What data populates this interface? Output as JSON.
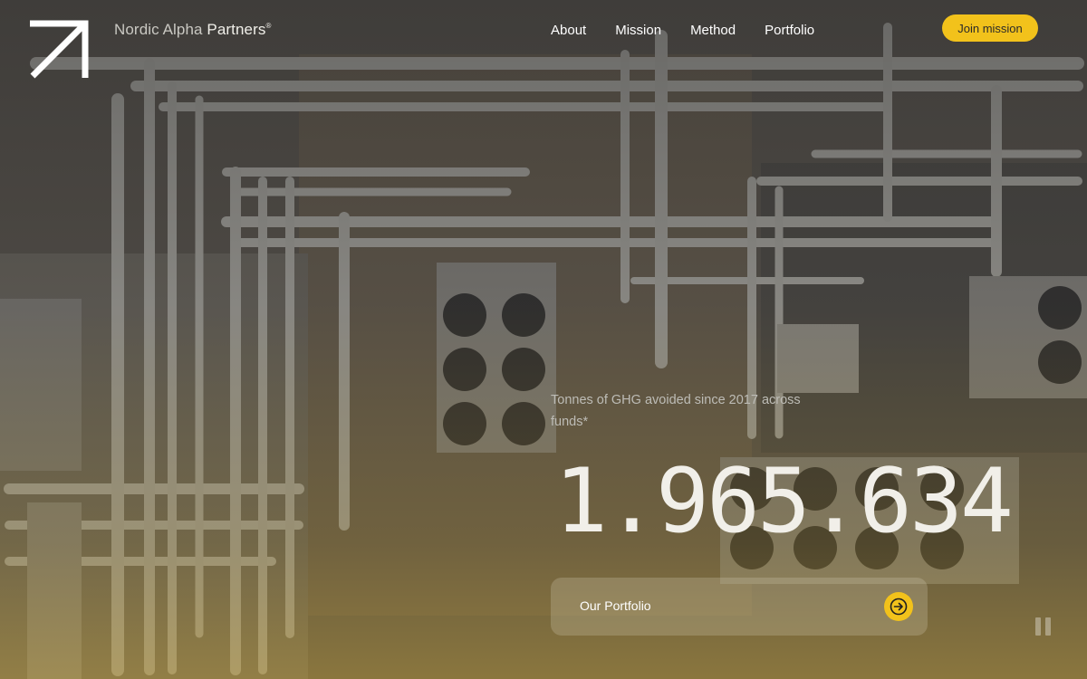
{
  "brand": {
    "light": "Nordic Alpha",
    "bold": "Partners",
    "mark": "®"
  },
  "nav": [
    {
      "label": "About"
    },
    {
      "label": "Mission"
    },
    {
      "label": "Method"
    },
    {
      "label": "Portfolio"
    }
  ],
  "cta": {
    "label": "Join mission"
  },
  "stat": {
    "caption": "Tonnes of GHG avoided since 2017 across funds*",
    "value": "1.965.634"
  },
  "portfolio_card": {
    "label": "Our Portfolio"
  },
  "icons": {
    "logo": "arrow-up-right-logo-icon",
    "arrow": "arrow-right-icon",
    "pause": "pause-icon"
  },
  "colors": {
    "accent": "#f2c21b",
    "text": "#ffffff",
    "caption": "#bdbcb6"
  }
}
